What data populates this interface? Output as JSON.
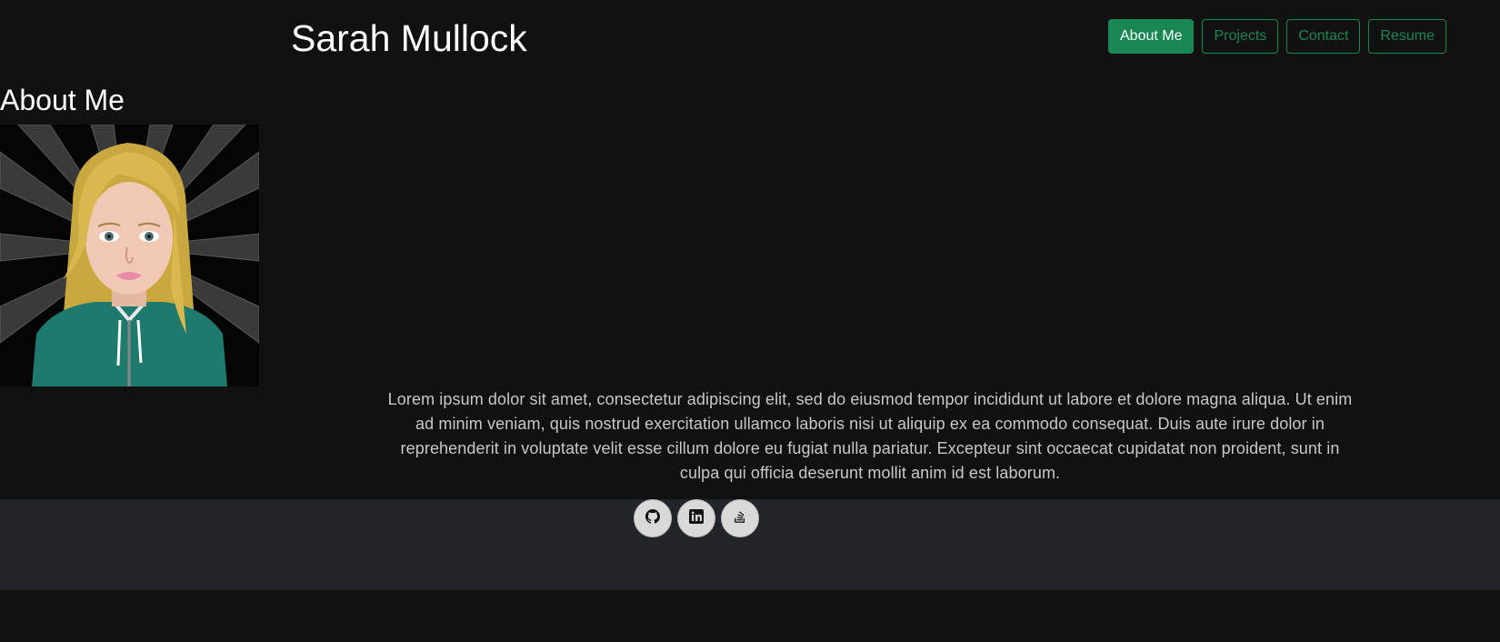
{
  "header": {
    "title": "Sarah Mullock",
    "nav": [
      {
        "label": "About Me",
        "active": true
      },
      {
        "label": "Projects",
        "active": false
      },
      {
        "label": "Contact",
        "active": false
      },
      {
        "label": "Resume",
        "active": false
      }
    ]
  },
  "about": {
    "heading": "About Me",
    "bio": "Lorem ipsum dolor sit amet, consectetur adipiscing elit, sed do eiusmod tempor incididunt ut labore et dolore magna aliqua. Ut enim ad minim veniam, quis nostrud exercitation ullamco laboris nisi ut aliquip ex ea commodo consequat. Duis aute irure dolor in reprehenderit in voluptate velit esse cillum dolore eu fugiat nulla pariatur. Excepteur sint occaecat cupidatat non proident, sunt in culpa qui officia deserunt mollit anim id est laborum."
  },
  "footer": {
    "social": [
      {
        "icon": "github-icon"
      },
      {
        "icon": "linkedin-icon"
      },
      {
        "icon": "stack-overflow-icon"
      }
    ]
  },
  "colors": {
    "background": "#111111",
    "accent": "#198754",
    "footer": "#212529",
    "text": "#ffffff",
    "body_text": "#c8c8c8"
  }
}
